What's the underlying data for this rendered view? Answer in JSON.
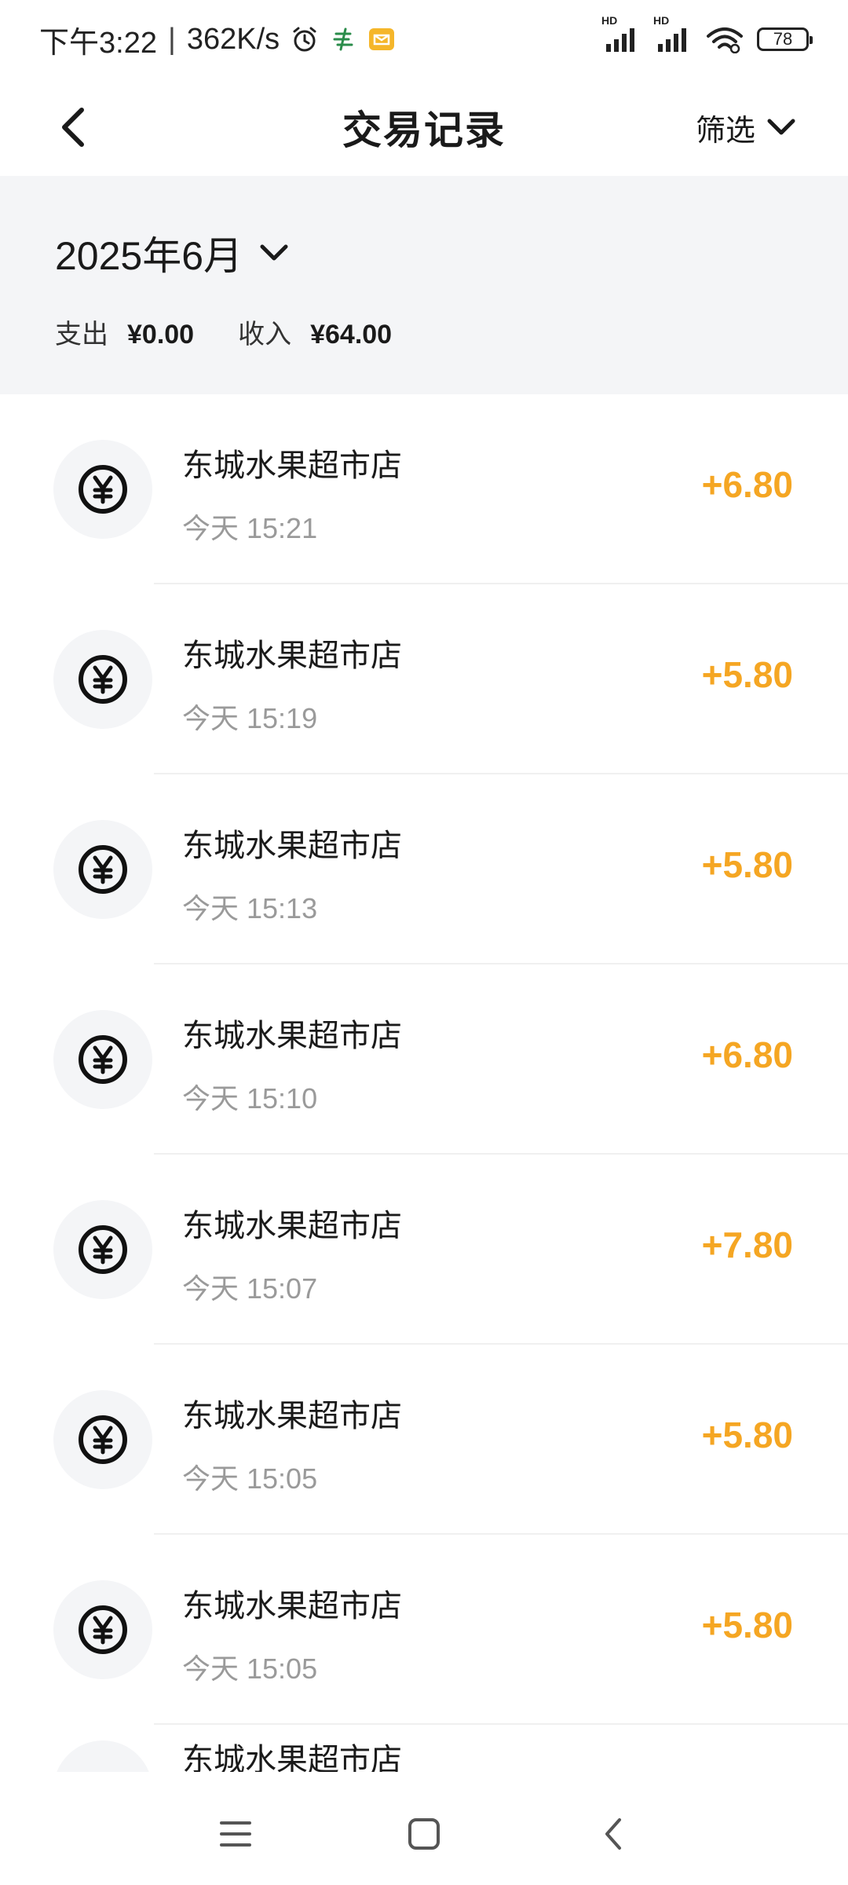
{
  "status_bar": {
    "time": "下午3:22",
    "speed": "362K/s",
    "network_1": "HD",
    "network_2": "HD",
    "battery": "78"
  },
  "header": {
    "title": "交易记录",
    "filter_label": "筛选"
  },
  "summary": {
    "month": "2025年6月",
    "expense_label": "支出",
    "expense_value": "¥0.00",
    "income_label": "收入",
    "income_value": "¥64.00"
  },
  "transactions": [
    {
      "merchant": "东城水果超市店",
      "time": "今天 15:21",
      "amount": "+6.80"
    },
    {
      "merchant": "东城水果超市店",
      "time": "今天 15:19",
      "amount": "+5.80"
    },
    {
      "merchant": "东城水果超市店",
      "time": "今天 15:13",
      "amount": "+5.80"
    },
    {
      "merchant": "东城水果超市店",
      "time": "今天 15:10",
      "amount": "+6.80"
    },
    {
      "merchant": "东城水果超市店",
      "time": "今天 15:07",
      "amount": "+7.80"
    },
    {
      "merchant": "东城水果超市店",
      "time": "今天 15:05",
      "amount": "+5.80"
    },
    {
      "merchant": "东城水果超市店",
      "time": "今天 15:05",
      "amount": "+5.80"
    },
    {
      "merchant": "东城水果超市店"
    }
  ],
  "colors": {
    "amount": "#f5a623",
    "summary_bg": "#f4f5f7",
    "secondary_text": "#9a9a9a"
  },
  "icons": {
    "back": "back-arrow-icon",
    "filter": "chevron-down-icon",
    "transaction": "yuan-coin-icon",
    "nav_menu": "menu-icon",
    "nav_home": "home-square-icon",
    "nav_back": "back-chevron-icon"
  }
}
